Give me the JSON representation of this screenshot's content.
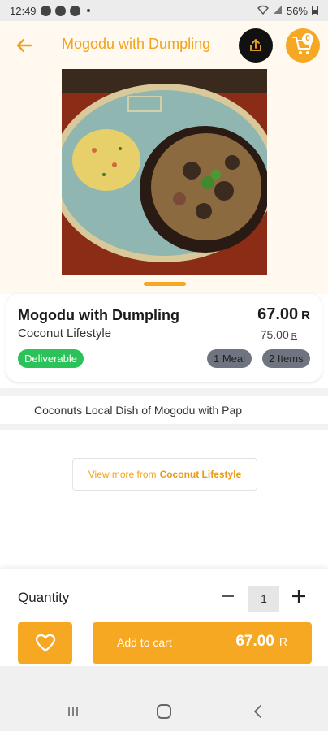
{
  "status_bar": {
    "time": "12:49",
    "battery": "56%"
  },
  "header": {
    "title": "Mogodu with Dumpling",
    "cart_count": "0"
  },
  "product": {
    "name": "Mogodu with Dumpling",
    "vendor": "Coconut Lifestyle",
    "price": "67.00",
    "old_price": "75.00",
    "currency": "R",
    "badge": "Deliverable",
    "tags": [
      "1 Meal",
      "2 Items"
    ],
    "description": "Coconuts Local Dish of Mogodu with Pap"
  },
  "view_more": {
    "prefix": "View more from",
    "vendor": "Coconut Lifestyle"
  },
  "quantity": {
    "label": "Quantity",
    "value": "1"
  },
  "actions": {
    "add_to_cart": "Add to cart",
    "price": "67.00",
    "currency": "R"
  },
  "colors": {
    "accent": "#f7a823",
    "green": "#2bc25a"
  }
}
